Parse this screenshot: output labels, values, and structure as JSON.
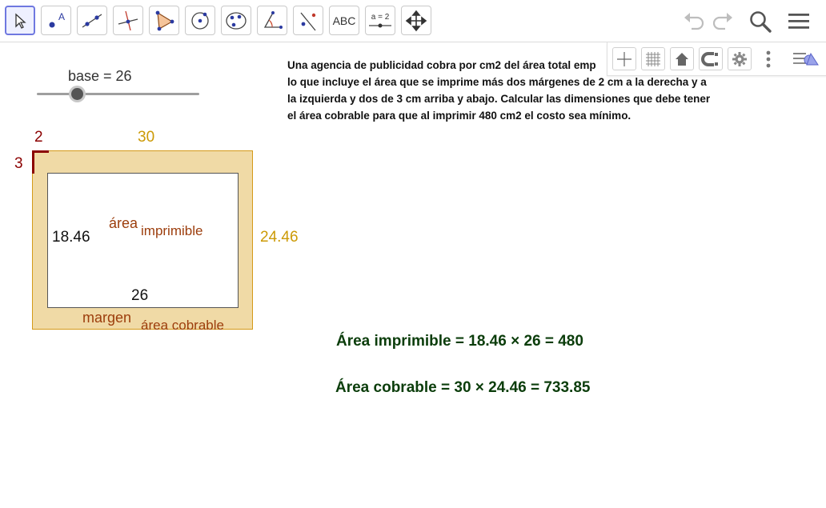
{
  "toolbar": {
    "tools": [
      {
        "name": "move-tool",
        "active": true
      },
      {
        "name": "point-tool",
        "label": "A"
      },
      {
        "name": "line-tool"
      },
      {
        "name": "perpendicular-line-tool"
      },
      {
        "name": "polygon-tool"
      },
      {
        "name": "circle-center-point-tool"
      },
      {
        "name": "conic-tool"
      },
      {
        "name": "angle-tool"
      },
      {
        "name": "reflect-tool"
      },
      {
        "name": "text-tool",
        "label": "ABC"
      },
      {
        "name": "slider-tool",
        "label": "a = 2"
      },
      {
        "name": "move-graphics-view-tool"
      }
    ]
  },
  "slider": {
    "label": "base = 26",
    "name": "base",
    "value": 26
  },
  "problem_text": "Una agencia de publicidad cobra por cm2 del área total emp lo que incluye el área que se imprime más dos márgenes de 2 cm a la derecha y a la izquierda y dos de 3 cm arriba y abajo. Calcular las dimensiones que debe tener el área cobrable para que al imprimir 480 cm2 el costo sea mínimo.",
  "problem_lines": [
    "Una agencia de publicidad cobra por cm2 del área total emp",
    "lo que incluye el área que se imprime más dos márgenes de 2 cm a la derecha y a",
    "la izquierda y dos de 3 cm arriba y abajo. Calcular las dimensiones que debe tener",
    "el área cobrable para que al imprimir 480 cm2 el costo sea mínimo."
  ],
  "drawing": {
    "margin_h": "2",
    "margin_v": "3",
    "outer_width": "30",
    "outer_height": "24.46",
    "inner_height": "18.46",
    "inner_width": "26",
    "label_area": "área",
    "label_imprimible": "imprimible",
    "label_margen": "margen",
    "label_cobrable": "área cobrable"
  },
  "equations": {
    "printable": "Área imprimible = 18.46 × 26 = 480",
    "billable": "Área cobrable = 30 × 24.46 = 733.85"
  },
  "colors": {
    "accent": "#6f78e0",
    "margin_fill": "#f0daa6",
    "margin_border": "#d49a1a",
    "dark_red": "#8b0000",
    "gold": "#cc9a06",
    "brown": "#9c3d0c",
    "equation_green": "#0b3d0b"
  }
}
